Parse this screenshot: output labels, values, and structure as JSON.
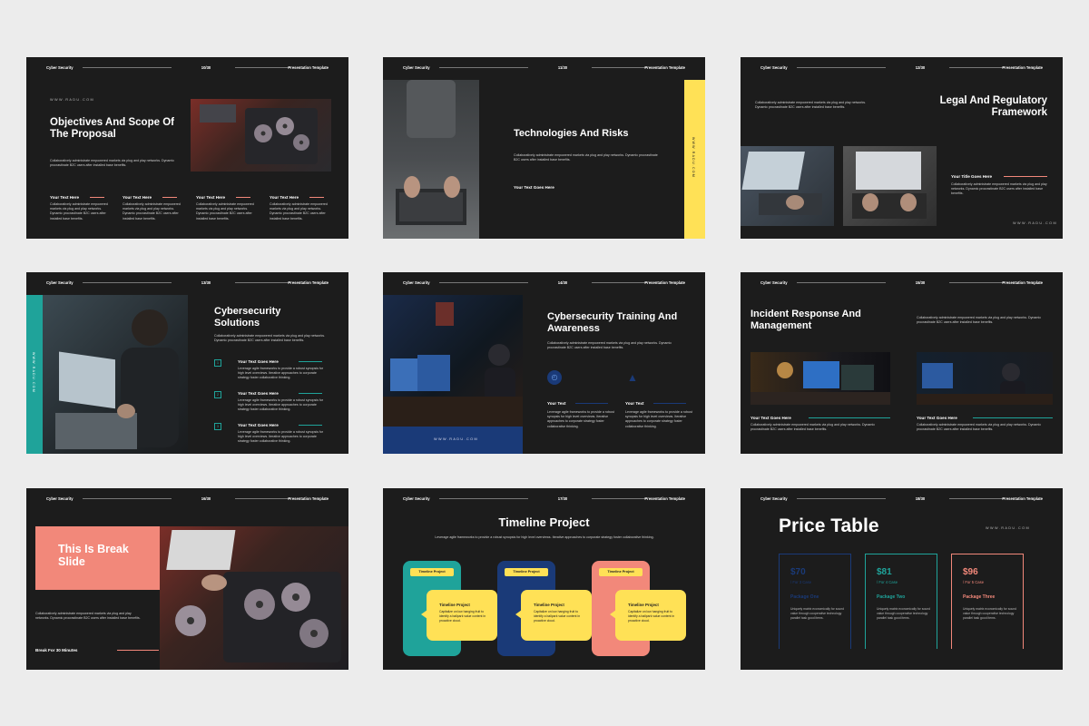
{
  "common": {
    "brand": "Cyber Security",
    "template": "Presentation Template",
    "url": "WWW.RADU.COM",
    "body_short": "Collaboratively administrate empowered markets via plug and play networks. Dynamic procrastinate B2C users after installed base benefits.",
    "body_mid": "Leverage agile frameworks to provide a robust synopsis for high level overviews. Iterative approaches to corporate strategy foster collaborative thinking.",
    "your_text_here": "Your Text Here",
    "your_text_goes_here": "Your Text Goes Here",
    "your_title_goes_here": "Your Title Goes Here",
    "your_text": "Your Text"
  },
  "colors": {
    "coral": "#f2887a",
    "teal": "#1fa39a",
    "navy": "#1a3a78",
    "yellow": "#ffe156",
    "dark": "#1c1c1c"
  },
  "slides": [
    {
      "page": "10/30",
      "title": "Objectives And Scope Of The Proposal"
    },
    {
      "page": "11/30",
      "title": "Technologies And Risks",
      "side": "WWW.RADU.COM"
    },
    {
      "page": "12/30",
      "title": "Legal And Regulatory Framework"
    },
    {
      "page": "13/30",
      "title": "Cybersecurity Solutions",
      "side": "WWW.RADU.COM",
      "nums": [
        "1",
        "2",
        "3"
      ]
    },
    {
      "page": "14/30",
      "title": "Cybersecurity Training And Awareness"
    },
    {
      "page": "15/30",
      "title": "Incident Response And Management"
    },
    {
      "page": "16/30",
      "title": "This Is Break Slide",
      "footer": "Break For 30 Minutes"
    },
    {
      "page": "17/30",
      "title": "Timeline Project",
      "tag": "Timeline Project",
      "bubble_title": "Timeline Project",
      "bubble_text": "Capitalize on low hanging fruit to identify a ballpark value content in proactive cloud."
    },
    {
      "page": "18/30",
      "title": "Price Table",
      "cards": [
        {
          "price": "$70",
          "case": "/  For 3 Case",
          "name": "Package One",
          "color": "#1a3a78"
        },
        {
          "price": "$81",
          "case": "/  For 4 Case",
          "name": "Package Two",
          "color": "#1fa39a"
        },
        {
          "price": "$96",
          "case": "/  For 5 Case",
          "name": "Package Three",
          "color": "#f2887a"
        }
      ],
      "card_desc": "Uniquely matrix economically for sound value through cooperative technology parallel task good items."
    }
  ]
}
